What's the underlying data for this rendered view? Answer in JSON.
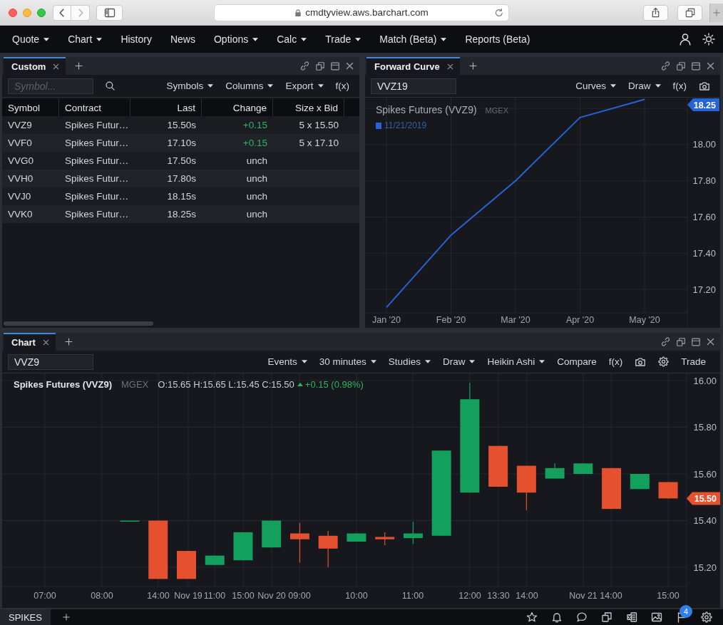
{
  "browser": {
    "url": "cmdtyview.aws.barchart.com",
    "back_button": {
      "disabled": false
    },
    "forward_button": {
      "disabled": true
    }
  },
  "nav": {
    "items": [
      {
        "label": "Quote",
        "dropdown": true
      },
      {
        "label": "Chart",
        "dropdown": true
      },
      {
        "label": "History",
        "dropdown": false
      },
      {
        "label": "News",
        "dropdown": false
      },
      {
        "label": "Options",
        "dropdown": true
      },
      {
        "label": "Calc",
        "dropdown": true
      },
      {
        "label": "Trade",
        "dropdown": true
      },
      {
        "label": "Match (Beta)",
        "dropdown": true
      },
      {
        "label": "Reports (Beta)",
        "dropdown": false
      }
    ]
  },
  "quote_panel": {
    "tabs": [
      {
        "label": "Custom",
        "selected": true
      }
    ],
    "symbol_field": {
      "placeholder": "Symbol..."
    },
    "menus": [
      {
        "label": "Symbols",
        "dropdown": true
      },
      {
        "label": "Columns",
        "dropdown": true
      },
      {
        "label": "Export",
        "dropdown": true
      },
      {
        "label": "f(x)",
        "dropdown": false
      }
    ],
    "table": {
      "columns": [
        "Symbol",
        "Contract",
        "Last",
        "Change",
        "Size x Bid"
      ],
      "rows": [
        {
          "symbol": "VVZ9",
          "contract": "Spikes Futur…",
          "last": "15.50s",
          "change": "+0.15",
          "color": "#2fb463",
          "size_x_bid": "5 x 15.50"
        },
        {
          "symbol": "VVF0",
          "contract": "Spikes Futur…",
          "last": "17.10s",
          "change": "+0.15",
          "color": "#2fb463",
          "size_x_bid": "5 x 17.10"
        },
        {
          "symbol": "VVG0",
          "contract": "Spikes Futur…",
          "last": "17.50s",
          "change": "unch",
          "color": "#d4d6da"
        },
        {
          "symbol": "VVH0",
          "contract": "Spikes Futur…",
          "last": "17.80s",
          "change": "unch",
          "color": "#d4d6da"
        },
        {
          "symbol": "VVJ0",
          "contract": "Spikes Futur…",
          "last": "18.15s",
          "change": "unch",
          "color": "#d4d6da"
        },
        {
          "symbol": "VVK0",
          "contract": "Spikes Futur…",
          "last": "18.25s",
          "change": "unch",
          "color": "#d4d6da"
        }
      ]
    }
  },
  "forward_curve_panel": {
    "tabs": [
      {
        "label": "Forward Curve",
        "selected": true
      }
    ],
    "symbol_field": {
      "value": "VVZ19"
    },
    "menus": [
      {
        "label": "Curves",
        "dropdown": true
      },
      {
        "label": "Draw",
        "dropdown": true
      },
      {
        "label": "f(x)",
        "dropdown": false
      }
    ],
    "exchange": "MGEX",
    "last_price_tag": "18.25",
    "chart_data": {
      "type": "line",
      "title": "Spikes Futures (VVZ9)",
      "categories": [
        "Jan '20",
        "Feb '20",
        "Mar '20",
        "Apr '20",
        "May '20"
      ],
      "series": [
        {
          "name": "11/21/2019",
          "color": "#2563d6",
          "values": [
            17.1,
            17.5,
            17.8,
            18.15,
            18.25
          ]
        }
      ],
      "ylim": [
        17.07,
        18.26
      ],
      "yticks": [
        {
          "value": 17.2,
          "label": "17.20"
        },
        {
          "value": 17.4,
          "label": "17.40"
        },
        {
          "value": 17.6,
          "label": "17.60"
        },
        {
          "value": 17.8,
          "label": "17.80"
        },
        {
          "value": 18.0,
          "label": "18.00"
        }
      ],
      "grid": true
    }
  },
  "chart_panel": {
    "tabs": [
      {
        "label": "Chart",
        "selected": true
      }
    ],
    "symbol_field": {
      "value": "VVZ9"
    },
    "menus": [
      {
        "label": "Events",
        "dropdown": true
      },
      {
        "label": "30 minutes",
        "dropdown": true
      },
      {
        "label": "Studies",
        "dropdown": true
      },
      {
        "label": "Draw",
        "dropdown": true
      },
      {
        "label": "Heikin Ashi",
        "dropdown": true
      },
      {
        "label": "Compare",
        "dropdown": false
      },
      {
        "label": "f(x)",
        "dropdown": false
      }
    ],
    "trade_button": "Trade",
    "header": {
      "title": "Spikes Futures (VVZ9)",
      "exchange": "MGEX",
      "ohlc": "O:15.65 H:15.65 L:15.45 C:15.50",
      "change": "+0.15 (0.98%)",
      "rising": true
    },
    "y_axis_labels": [
      "16.00",
      "15.80",
      "15.60",
      "15.40",
      "15.20"
    ],
    "x_axis_labels": [
      "07:00",
      "08:00",
      "14:00",
      "Nov 19",
      "11:00",
      "15:00",
      "Nov 20",
      "09:00",
      "10:00",
      "11:00",
      "12:00",
      "13:30",
      "14:00",
      "Nov 21",
      "14:00",
      "15:00"
    ],
    "last_price_tag": "15.50"
  },
  "workspace_bar": {
    "tabs": [
      {
        "label": "SPIKES",
        "selected": true
      }
    ],
    "notification_count": "4"
  }
}
